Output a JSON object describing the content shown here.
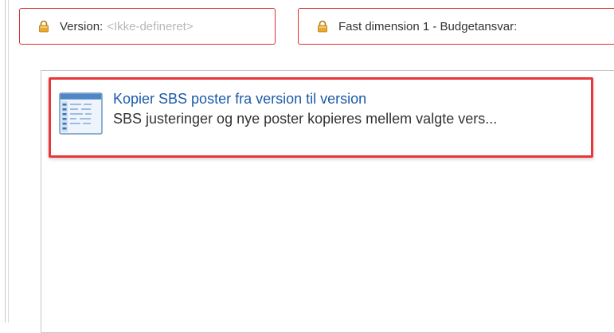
{
  "filters": {
    "version": {
      "label": "Version:",
      "value": "<Ikke-defineret>"
    },
    "dimension": {
      "label": "Fast dimension 1 - Budgetansvar:"
    }
  },
  "list": {
    "items": [
      {
        "title": "Kopier SBS poster fra version til version",
        "description": "SBS justeringer og nye poster kopieres mellem valgte vers..."
      }
    ]
  },
  "colors": {
    "highlight_border": "#e8363b",
    "filter_border": "#d9302f",
    "link": "#1a5aa8",
    "lock": "#e0a030"
  },
  "icons": {
    "lock": "lock-icon",
    "item": "table-document-icon"
  }
}
